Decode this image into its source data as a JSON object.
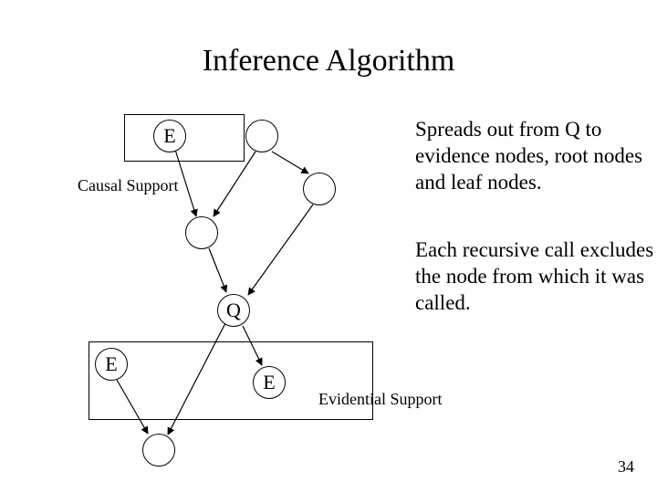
{
  "title": "Inference Algorithm",
  "paragraphs": {
    "p1": "Spreads out from Q to  evidence nodes, root nodes and leaf nodes.",
    "p2": "Each recursive call excludes the node from which it was called."
  },
  "labels": {
    "causal_support": "Causal Support",
    "evidential_support": "Evidential Support"
  },
  "nodes": {
    "E_top": "E",
    "Q": "Q",
    "E_left": "E",
    "E_right": "E"
  },
  "page_number": "34"
}
